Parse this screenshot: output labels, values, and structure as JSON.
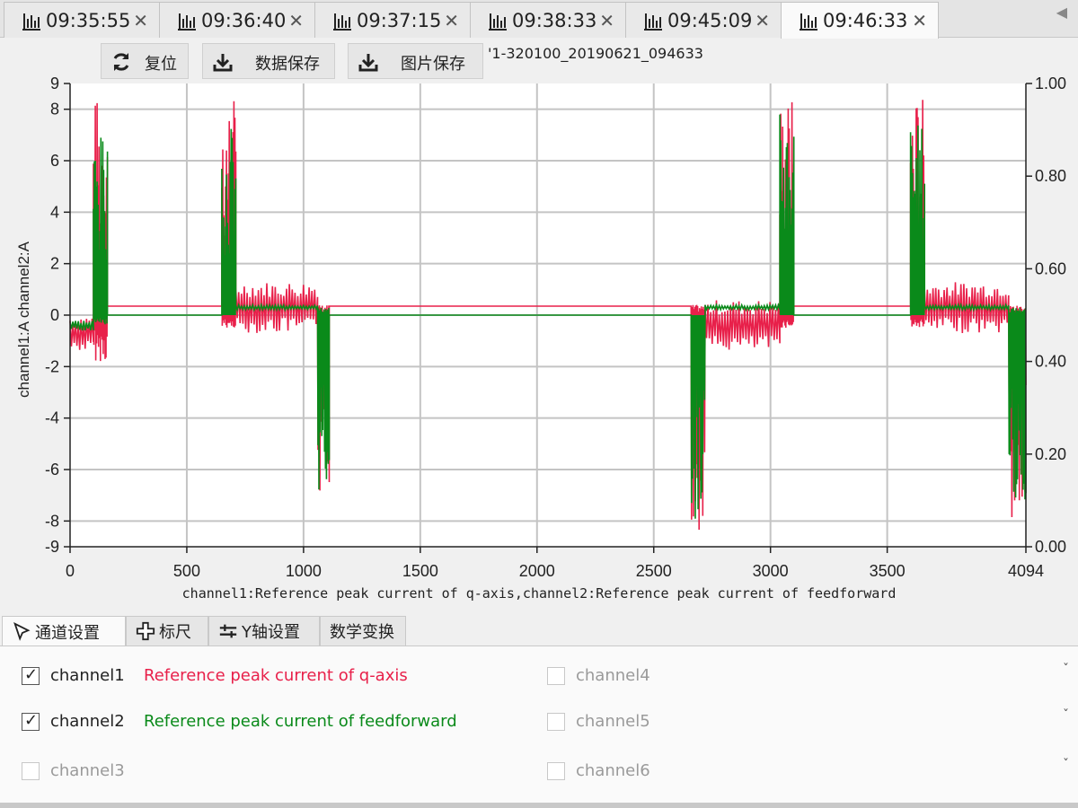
{
  "tabs": [
    {
      "label": "09:35:55",
      "active": false
    },
    {
      "label": "09:36:40",
      "active": false
    },
    {
      "label": "09:37:15",
      "active": false
    },
    {
      "label": "09:38:33",
      "active": false
    },
    {
      "label": "09:45:09",
      "active": false
    },
    {
      "label": "09:46:33",
      "active": true
    }
  ],
  "tab_scroll_glyph": "◀",
  "toolbar": {
    "reset_label": "复位",
    "save_data_label": "数据保存",
    "save_image_label": "图片保存"
  },
  "file_label": "'1-320100_20190621_094633",
  "chart_data": {
    "type": "line",
    "xlabel": "channel1:Reference peak current of q-axis,channel2:Reference peak current of feedforward",
    "ylabel": "channel1:A channel2:A",
    "xlim": [
      0,
      4094
    ],
    "ylim_left": [
      -9,
      9
    ],
    "ylim_right": [
      0.0,
      1.0
    ],
    "x_ticks": [
      "0",
      "500",
      "1000",
      "1500",
      "2000",
      "2500",
      "3000",
      "3500",
      "4094"
    ],
    "y_ticks_left": [
      "9",
      "8",
      "6",
      "4",
      "2",
      "0",
      "-2",
      "-4",
      "-6",
      "-8",
      "-9"
    ],
    "y_ticks_right": [
      "1.00",
      "0.80",
      "0.60",
      "0.40",
      "0.20",
      "0.00"
    ],
    "grid": true,
    "colors": {
      "channel1": "#e8204a",
      "channel2": "#0a8a1a"
    },
    "series": [
      {
        "name": "channel1",
        "segments": [
          {
            "x": [
              0,
              100
            ],
            "base": -0.7,
            "amp": 0.7
          },
          {
            "x": [
              100,
              160
            ],
            "peak": 8.5,
            "min": -1.8
          },
          {
            "x": [
              160,
              650
            ],
            "base": 0.35
          },
          {
            "x": [
              650,
              710
            ],
            "peak": 8.5,
            "min": -0.5
          },
          {
            "x": [
              710,
              1060
            ],
            "base": 0.3,
            "amp": 1.0
          },
          {
            "x": [
              1060,
              1110
            ],
            "peak": 0.4,
            "min": -8.5
          },
          {
            "x": [
              1110,
              2660
            ],
            "base": 0.35
          },
          {
            "x": [
              2660,
              2720
            ],
            "peak": 0.4,
            "min": -8.5
          },
          {
            "x": [
              2720,
              3040
            ],
            "base": -0.4,
            "amp": 1.0
          },
          {
            "x": [
              3040,
              3100
            ],
            "peak": 8.5,
            "min": -0.5
          },
          {
            "x": [
              3100,
              3600
            ],
            "base": 0.35
          },
          {
            "x": [
              3600,
              3660
            ],
            "peak": 8.5,
            "min": -0.5
          },
          {
            "x": [
              3660,
              4020
            ],
            "base": 0.3,
            "amp": 1.0
          },
          {
            "x": [
              4020,
              4094
            ],
            "peak": 0.4,
            "min": -8.5
          }
        ]
      },
      {
        "name": "channel2",
        "segments": [
          {
            "x": [
              0,
              100
            ],
            "base": -0.4,
            "amp": 0.2
          },
          {
            "x": [
              100,
              160
            ],
            "peak": 7.0,
            "min": -0.4
          },
          {
            "x": [
              160,
              650
            ],
            "base": 0.0
          },
          {
            "x": [
              650,
              710
            ],
            "peak": 7.5,
            "min": 0.0
          },
          {
            "x": [
              710,
              1060
            ],
            "base": 0.3,
            "amp": 0.1
          },
          {
            "x": [
              1060,
              1110
            ],
            "peak": 0.3,
            "min": -7.0
          },
          {
            "x": [
              1110,
              2660
            ],
            "base": 0.0
          },
          {
            "x": [
              2660,
              2720
            ],
            "peak": 0.0,
            "min": -8.0
          },
          {
            "x": [
              2720,
              3040
            ],
            "base": 0.3,
            "amp": 0.1
          },
          {
            "x": [
              3040,
              3100
            ],
            "peak": 8.2,
            "min": 0.0
          },
          {
            "x": [
              3100,
              3600
            ],
            "base": 0.0
          },
          {
            "x": [
              3600,
              3660
            ],
            "peak": 7.5,
            "min": 0.0
          },
          {
            "x": [
              3660,
              4020
            ],
            "base": 0.3,
            "amp": 0.1
          },
          {
            "x": [
              4020,
              4094
            ],
            "peak": 0.3,
            "min": -7.5
          }
        ]
      }
    ]
  },
  "bottom_tabs": {
    "channel_settings": "通道设置",
    "ruler": "标尺",
    "y_axis_settings": "Y轴设置",
    "math_transform": "数学变换"
  },
  "channels": [
    {
      "name": "channel1",
      "checked": true,
      "enabled": true,
      "description": "Reference peak current of q-axis",
      "color": "#e8204a"
    },
    {
      "name": "channel2",
      "checked": true,
      "enabled": true,
      "description": "Reference peak current of feedforward",
      "color": "#0a8a1a"
    },
    {
      "name": "channel3",
      "checked": false,
      "enabled": false,
      "description": "",
      "color": "#9a9a9a"
    },
    {
      "name": "channel4",
      "checked": false,
      "enabled": false,
      "description": "",
      "color": "#9a9a9a"
    },
    {
      "name": "channel5",
      "checked": false,
      "enabled": false,
      "description": "",
      "color": "#9a9a9a"
    },
    {
      "name": "channel6",
      "checked": false,
      "enabled": false,
      "description": "",
      "color": "#9a9a9a"
    }
  ],
  "check_glyph": "✓",
  "corner_ticks": [
    "ˇ",
    "ˇ",
    "ˇ"
  ]
}
